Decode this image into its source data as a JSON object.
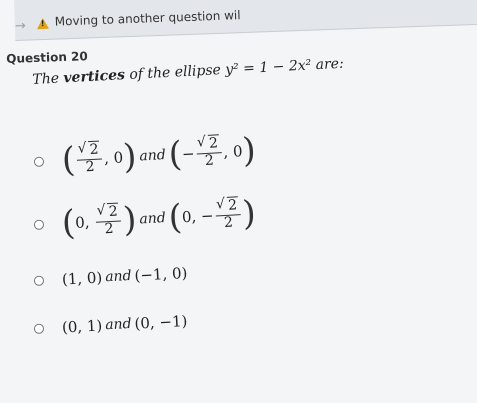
{
  "banner": {
    "message": "Moving to another question wil"
  },
  "question": {
    "label": "Question 20",
    "prompt_before": "The ",
    "prompt_bold": "vertices",
    "prompt_after": " of the ellipse y² = 1 − 2x² are:"
  },
  "options": [
    {
      "label": "(√2/2, 0) and (−√2/2, 0)",
      "first": {
        "x": "√2/2",
        "y": "0"
      },
      "second": {
        "x": "−√2/2",
        "y": "0"
      }
    },
    {
      "label": "(0, √2/2) and (0, −√2/2)",
      "first": {
        "x": "0",
        "y": "√2/2"
      },
      "second": {
        "x": "0",
        "y": "−√2/2"
      }
    },
    {
      "label": "(1, 0) and (−1, 0)",
      "text": "(1, 0)",
      "conj": "and",
      "text2": "(−1, 0)"
    },
    {
      "label": "(0, 1) and (0, −1)",
      "text": "(0, 1)",
      "conj": "and",
      "text2": "(0, −1)"
    }
  ],
  "math": {
    "sqrt_radicand": "2",
    "denominator": "2",
    "zero": "0",
    "minus": "−",
    "comma": ",",
    "and": "and"
  }
}
